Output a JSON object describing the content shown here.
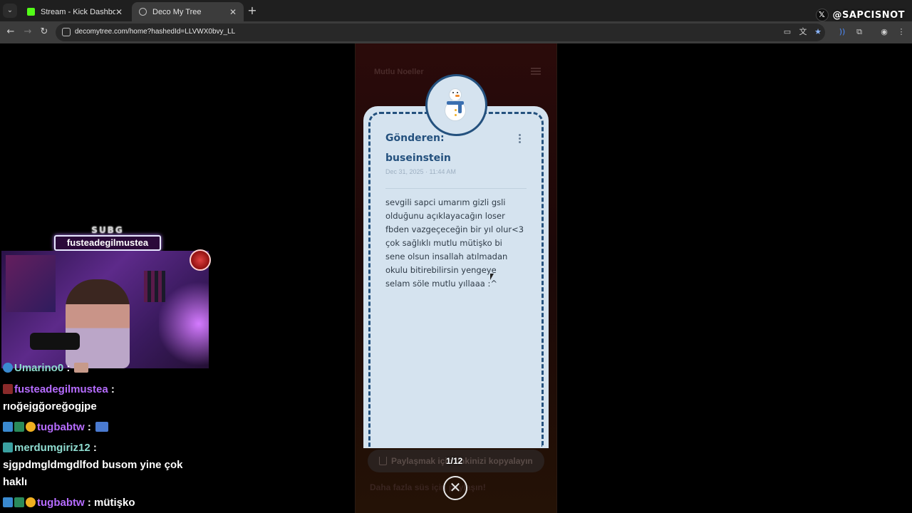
{
  "browser": {
    "tabs": [
      {
        "title": "Stream - Kick Dashboard",
        "active": false,
        "favicon_color": "#53fc18"
      },
      {
        "title": "Deco My Tree",
        "active": true,
        "favicon_color": "#bdbdbd"
      }
    ],
    "url": "decomytree.com/home?hashedId=LLVWX0bvy_LL"
  },
  "watermark": {
    "handle": "@SAPCISNOT",
    "icon": "x-logo-icon"
  },
  "app": {
    "title": "Mutlu Noeller"
  },
  "letter": {
    "from_label": "Gönderen:",
    "sender": "buseinstein",
    "date": "Dec 31, 2025 · 11:44 AM",
    "message": "sevgili sapci umarım gizli gsli\nolduğunu açıklayacağın loser\nfbden vazgeçeceğin bir yıl olur<3\nçok sağlıklı mutlu mütişko bi\nsene olsun insallah atılmadan\nokulu bitirebilirsin yengeye\nselam söle mutlu yıllaaa :^",
    "avatar": "snowman-icon"
  },
  "footer": {
    "share_label": "Paylaşmak için linkinizi kopyalayın",
    "counter": "1/12",
    "more_text": "Daha fazla süs için paylaşın!"
  },
  "overlay": {
    "sub_title": "SUBG",
    "sub_name": "fusteadegilmustea"
  },
  "chat": [
    {
      "user": "Umarino0",
      "sep": " :",
      "text": ""
    },
    {
      "user": "fusteadegilmustea",
      "sep": " :",
      "text": ""
    },
    {
      "user": "",
      "sep": "",
      "text": "rıoğejgğoreğogjpe"
    },
    {
      "user": "tugbabtw",
      "sep": " :",
      "text": ""
    },
    {
      "user": "merdumgiriz12",
      "sep": " :",
      "text": ""
    },
    {
      "user": "",
      "sep": "",
      "text": "sjgpdmgldmgdlfod busom yine çok"
    },
    {
      "user": "",
      "sep": "",
      "text": "haklı"
    },
    {
      "user": "tugbabtw",
      "sep": " :",
      "text": " mütişko"
    }
  ]
}
